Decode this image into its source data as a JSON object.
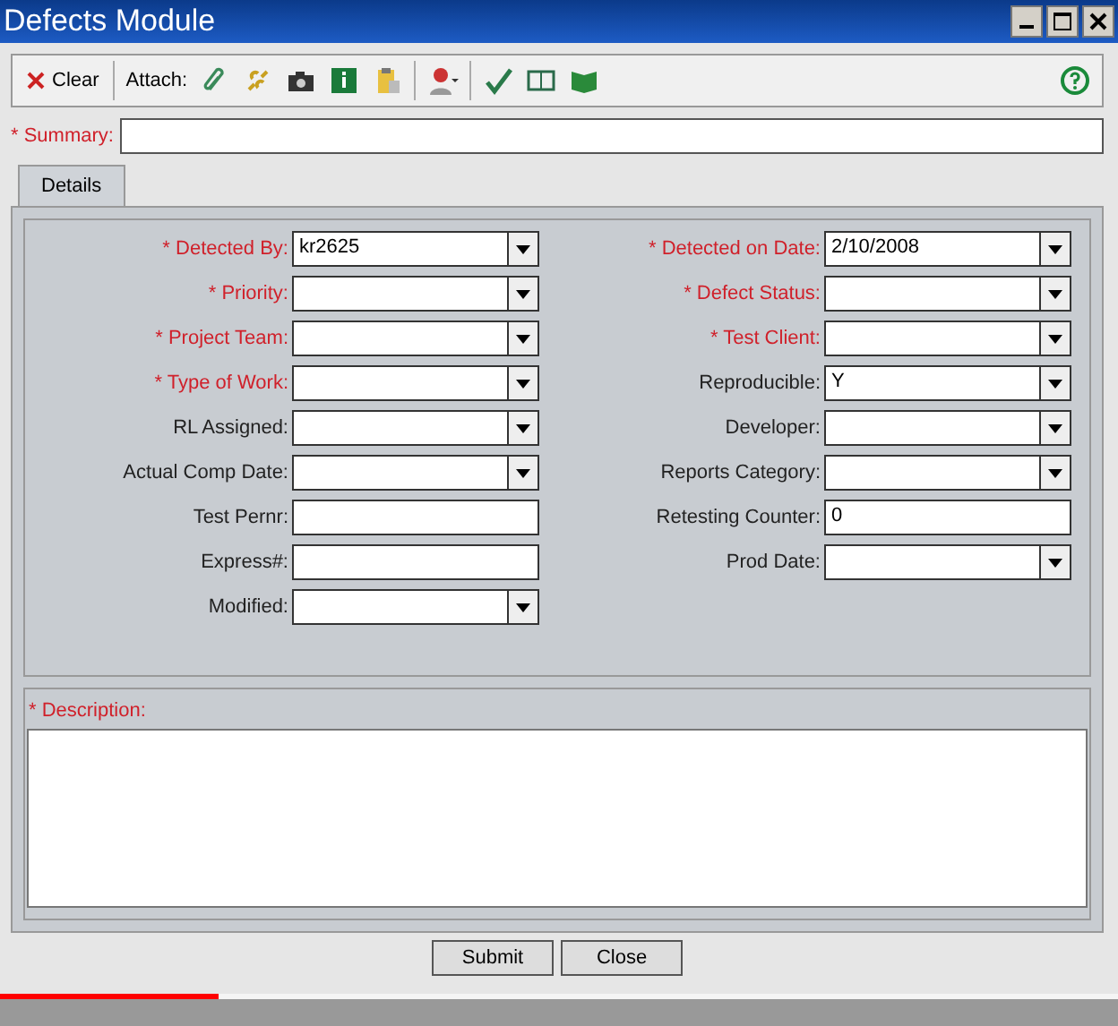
{
  "window": {
    "title": "Defects Module"
  },
  "toolbar": {
    "clear": "Clear",
    "attach": "Attach:"
  },
  "summary": {
    "label": "* Summary:",
    "required": true
  },
  "tabs": [
    {
      "label": "Details",
      "selected": true
    }
  ],
  "left_fields": [
    {
      "label": "* Detected By:",
      "required": true,
      "kind": "dropdown",
      "value": "kr2625"
    },
    {
      "label": "* Priority:",
      "required": true,
      "kind": "dropdown"
    },
    {
      "label": "* Project Team:",
      "required": true,
      "kind": "dropdown"
    },
    {
      "label": "* Type of Work:",
      "required": true,
      "kind": "dropdown"
    },
    {
      "label": "RL Assigned:",
      "required": false,
      "kind": "dropdown"
    },
    {
      "label": "Actual Comp Date:",
      "required": false,
      "kind": "dropdown"
    },
    {
      "label": "Test Pernr:",
      "required": false,
      "kind": "text"
    },
    {
      "label": "Express#:",
      "required": false,
      "kind": "text"
    },
    {
      "label": "Modified:",
      "required": false,
      "kind": "dropdown"
    }
  ],
  "right_fields": [
    {
      "label": "* Detected on Date:",
      "required": true,
      "kind": "dropdown",
      "value": "2/10/2008"
    },
    {
      "label": "* Defect Status:",
      "required": true,
      "kind": "dropdown"
    },
    {
      "label": "* Test Client:",
      "required": true,
      "kind": "dropdown"
    },
    {
      "label": "Reproducible:",
      "required": false,
      "kind": "dropdown",
      "value": "Y"
    },
    {
      "label": "Developer:",
      "required": false,
      "kind": "dropdown"
    },
    {
      "label": "Reports Category:",
      "required": false,
      "kind": "dropdown"
    },
    {
      "label": "Retesting Counter:",
      "required": false,
      "kind": "text",
      "value": "0"
    },
    {
      "label": "Prod Date:",
      "required": false,
      "kind": "dropdown"
    }
  ],
  "description": {
    "label": "* Description:",
    "required": true
  },
  "buttons": [
    "Submit",
    "Close"
  ],
  "video_progress": {
    "level": 0.195
  }
}
